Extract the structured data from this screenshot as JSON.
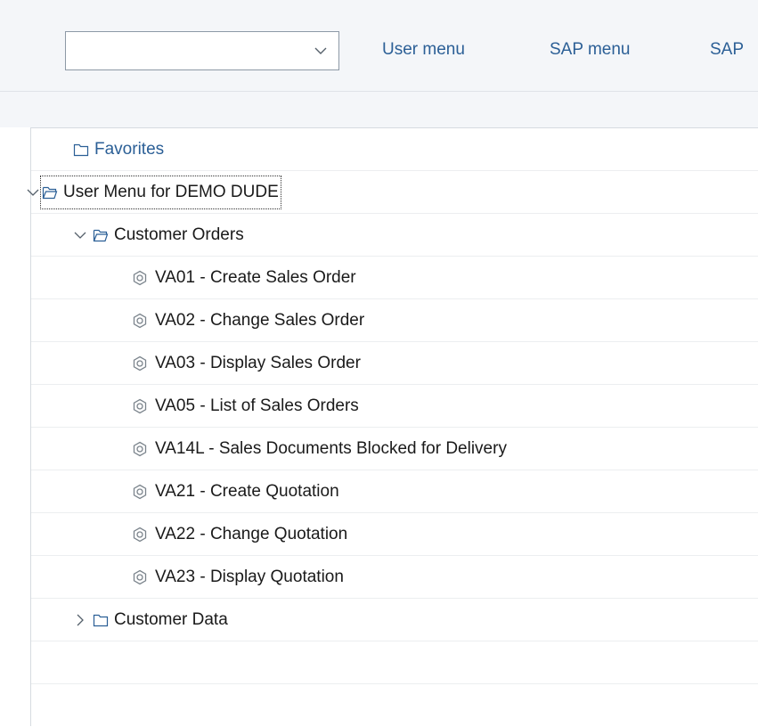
{
  "toolbar": {
    "combo_value": "",
    "links": [
      "User menu",
      "SAP menu",
      "SAP"
    ]
  },
  "tree": {
    "favorites": "Favorites",
    "user_menu": "User Menu for DEMO DUDE",
    "customer_orders": "Customer Orders",
    "transactions": [
      "VA01 - Create Sales Order",
      "VA02 - Change Sales Order",
      "VA03 - Display Sales Order",
      "VA05 - List of Sales Orders",
      "VA14L - Sales Documents Blocked for Delivery",
      "VA21 - Create Quotation",
      "VA22 - Change Quotation",
      "VA23 - Display Quotation"
    ],
    "customer_data": "Customer Data"
  },
  "icons": {
    "folder": "folder-icon",
    "folder_open": "folder-open-icon",
    "transaction": "transaction-gear-icon",
    "expand": "chevron-right-icon",
    "collapse": "chevron-down-icon"
  },
  "colors": {
    "link": "#2b5f96",
    "toolbar_bg": "#f4f6f9",
    "text": "#1a1a1a"
  }
}
